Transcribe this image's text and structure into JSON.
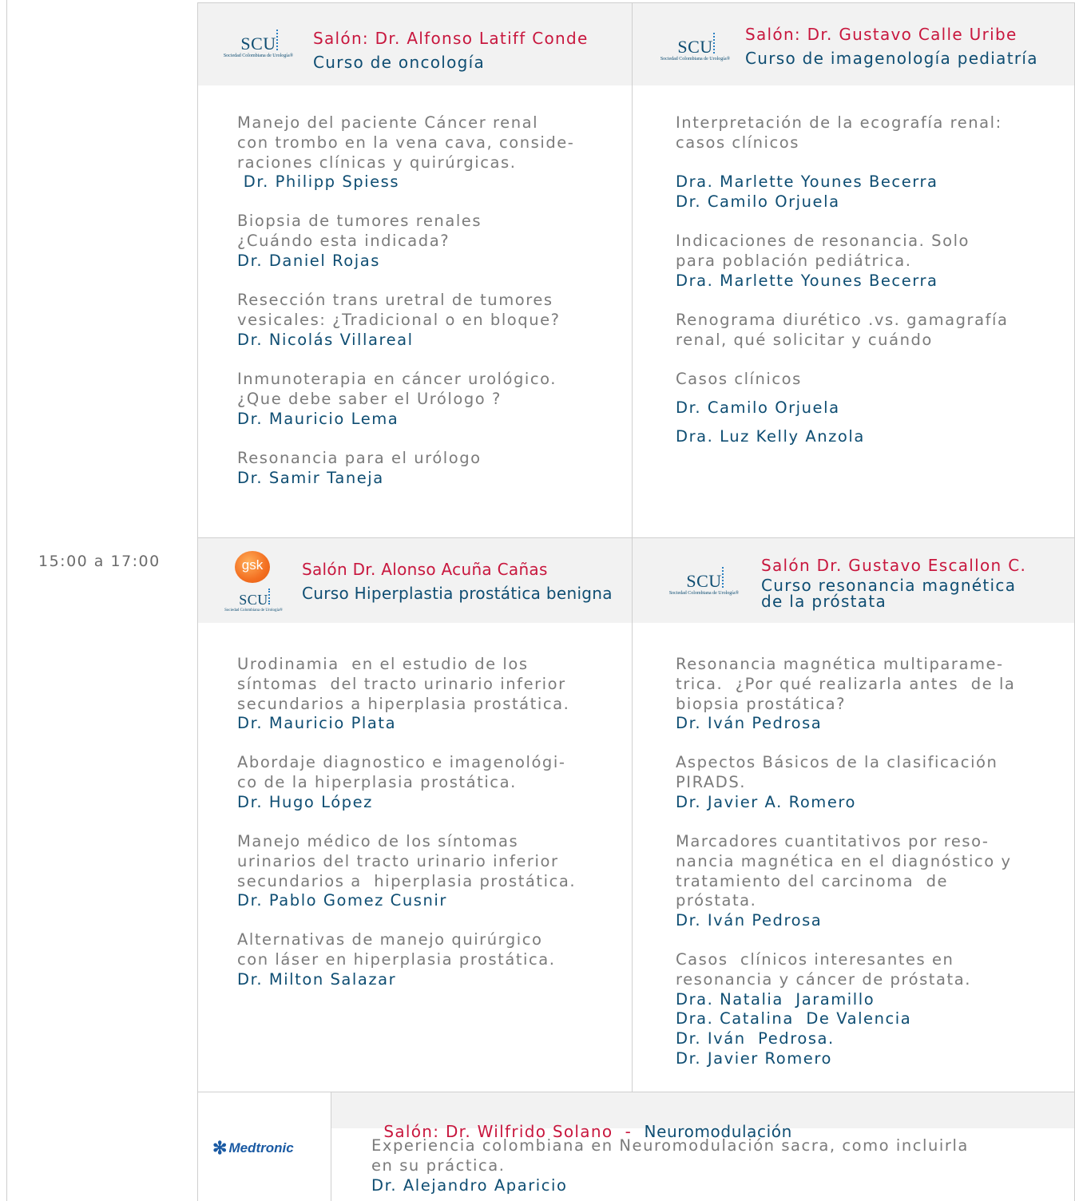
{
  "time_slot": "15:00 a 17:00",
  "sessions": [
    {
      "salon": "Salón: Dr. Alfonso Latiff Conde",
      "course": "Curso de oncología",
      "logo": "SCU",
      "items": [
        {
          "title_lines": [
            "Manejo del paciente Cáncer renal",
            "con trombo en la vena cava, conside-",
            "raciones clínicas y quirúrgicas."
          ],
          "doctors": [
            " Dr. Philipp Spiess"
          ]
        },
        {
          "title_lines": [
            "Biopsia de tumores renales",
            "¿Cuándo esta indicada?"
          ],
          "doctors": [
            "Dr. Daniel Rojas"
          ]
        },
        {
          "title_lines": [
            "Resección trans uretral de tumores",
            "vesicales: ¿Tradicional o en bloque?"
          ],
          "doctors": [
            "Dr. Nicolás Villareal"
          ]
        },
        {
          "title_lines": [
            "Inmunoterapia en cáncer urológico.",
            "¿Que debe saber el Urólogo ?"
          ],
          "doctors": [
            "Dr. Mauricio Lema"
          ]
        },
        {
          "title_lines": [
            "Resonancia para el urólogo"
          ],
          "doctors": [
            "Dr. Samir Taneja"
          ]
        }
      ]
    },
    {
      "salon": "Salón: Dr. Gustavo Calle Uribe",
      "course": "Curso de imagenología pediatría",
      "logo": "SCU",
      "items": [
        {
          "title_lines": [
            "Interpretación de la ecografía renal:",
            "casos clínicos"
          ],
          "doctors": [
            "Dra. Marlette Younes Becerra",
            "Dr. Camilo Orjuela"
          ]
        },
        {
          "title_lines": [
            "Indicaciones de resonancia. Solo",
            "para población pediátrica."
          ],
          "doctors": [
            "Dra. Marlette Younes Becerra"
          ]
        },
        {
          "title_lines": [
            "Renograma diurético .vs. gamagrafía",
            "renal, qué solicitar y cuándo"
          ],
          "doctors": []
        },
        {
          "title_lines": [
            "Casos clínicos"
          ],
          "doctors": [
            "Dr. Camilo Orjuela",
            "Dra. Luz Kelly Anzola"
          ]
        }
      ]
    },
    {
      "salon": "Salón Dr. Alonso Acuña Cañas",
      "course": "Curso Hiperplastia prostática benigna",
      "logo": "gsk",
      "items": [
        {
          "title_lines": [
            "Urodinamia  en el estudio de los",
            "síntomas  del tracto urinario inferior",
            "secundarios a hiperplasia prostática."
          ],
          "doctors": [
            "Dr. Mauricio Plata"
          ]
        },
        {
          "title_lines": [
            "Abordaje diagnostico e imagenológi-",
            "co de la hiperplasia prostática."
          ],
          "doctors": [
            "Dr. Hugo López"
          ]
        },
        {
          "title_lines": [
            "Manejo médico de los síntomas",
            "urinarios del tracto urinario inferior",
            "secundarios a  hiperplasia prostática."
          ],
          "doctors": [
            "Dr. Pablo Gomez Cusnir"
          ]
        },
        {
          "title_lines": [
            "Alternativas de manejo quirúrgico",
            "con láser en hiperplasia prostática."
          ],
          "doctors": [
            "Dr. Milton Salazar"
          ]
        }
      ]
    },
    {
      "salon": "Salón Dr. Gustavo Escallon C.",
      "course_lines": [
        "Curso resonancia magnética",
        "de la próstata"
      ],
      "logo": "SCU",
      "items": [
        {
          "title_lines": [
            "Resonancia magnética multiparame-",
            "trica.  ¿Por qué realizarla antes  de la",
            "biopsia prostática?"
          ],
          "doctors": [
            "Dr. Iván Pedrosa"
          ]
        },
        {
          "title_lines": [
            "Aspectos Básicos de la clasificación",
            "PIRADS."
          ],
          "doctors": [
            "Dr. Javier A. Romero"
          ]
        },
        {
          "title_lines": [
            "Marcadores cuantitativos por reso-",
            "nancia magnética en el diagnóstico y",
            "tratamiento del carcinoma  de",
            "próstata."
          ],
          "doctors": [
            "Dr. Iván Pedrosa"
          ]
        },
        {
          "title_lines": [
            "Casos  clínicos interesantes en",
            "resonancia y cáncer de próstata."
          ],
          "doctors": [
            "Dra. Natalia  Jaramillo",
            "Dra. Catalina  De Valencia",
            "Dr. Iván  Pedrosa.",
            "Dr. Javier Romero"
          ]
        }
      ]
    }
  ],
  "neuro": {
    "salon": "Salón: Dr. Wilfrido Solano  -  ",
    "course": "Neuromodulación",
    "logo": "Medtronic",
    "title_lines": [
      "Experiencia colombiana en Neuromodulación sacra, como incluirla",
      "en su práctica."
    ],
    "doctor": "Dr. Alejandro Aparicio"
  },
  "logos": {
    "scu_text": "SCU",
    "scu_subtitle": "Sociedad Colombiana de Urología®",
    "gsk_text": "gsk",
    "medtronic_text": "Medtronic"
  },
  "colors": {
    "salon": "#c8173e",
    "doctor": "#0e4d72",
    "title": "#7b7b7b",
    "header_bg": "#f2f2f2",
    "border": "#cfcfcf"
  }
}
